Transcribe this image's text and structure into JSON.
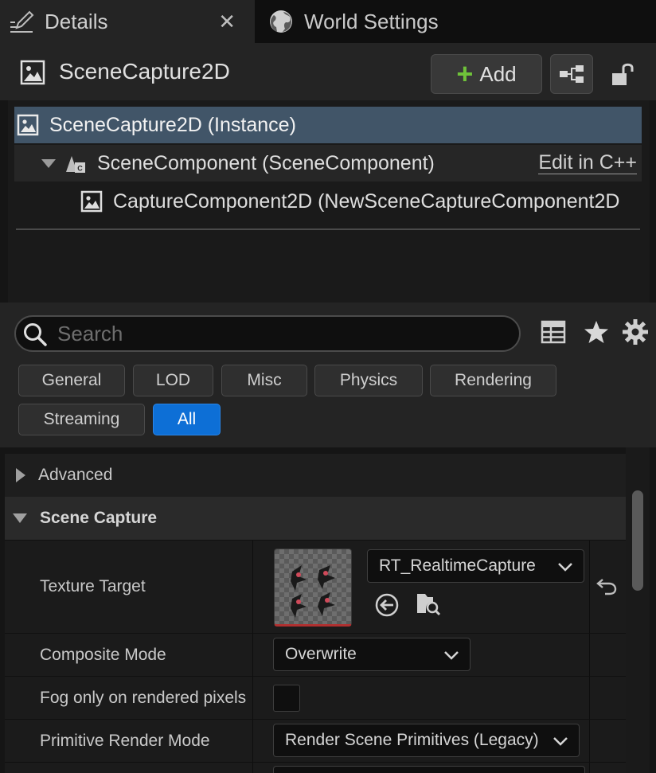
{
  "tabs": [
    {
      "label": "Details",
      "icon": "pencil-details-icon",
      "active": true
    },
    {
      "label": "World Settings",
      "icon": "globe-icon",
      "active": false
    }
  ],
  "tab_close_glyph": "✕",
  "header": {
    "title": "SceneCapture2D",
    "add_label": "Add"
  },
  "tree": {
    "rows": [
      {
        "label": "SceneCapture2D (Instance)",
        "selected": true
      },
      {
        "label": "SceneComponent (SceneComponent)",
        "action": "Edit in C++"
      },
      {
        "label": "CaptureComponent2D (NewSceneCaptureComponent2D"
      }
    ]
  },
  "search": {
    "placeholder": "Search",
    "value": ""
  },
  "filters": [
    {
      "label": "General"
    },
    {
      "label": "LOD"
    },
    {
      "label": "Misc"
    },
    {
      "label": "Physics"
    },
    {
      "label": "Rendering"
    },
    {
      "label": "Streaming"
    },
    {
      "label": "All",
      "active": true
    }
  ],
  "sections": {
    "advanced": "Advanced",
    "scene_capture": "Scene Capture"
  },
  "properties": {
    "texture_target": {
      "name": "Texture Target",
      "value": "RT_RealtimeCapture"
    },
    "composite_mode": {
      "name": "Composite Mode",
      "value": "Overwrite"
    },
    "fog": {
      "name": "Fog only on rendered pixels",
      "checked": false
    },
    "primitive_render_mode": {
      "name": "Primitive Render Mode",
      "value": "Render Scene Primitives (Legacy)"
    }
  },
  "colors": {
    "accent_blue": "#0d6fd6",
    "selection": "#415568",
    "add_green": "#6fc23a"
  }
}
